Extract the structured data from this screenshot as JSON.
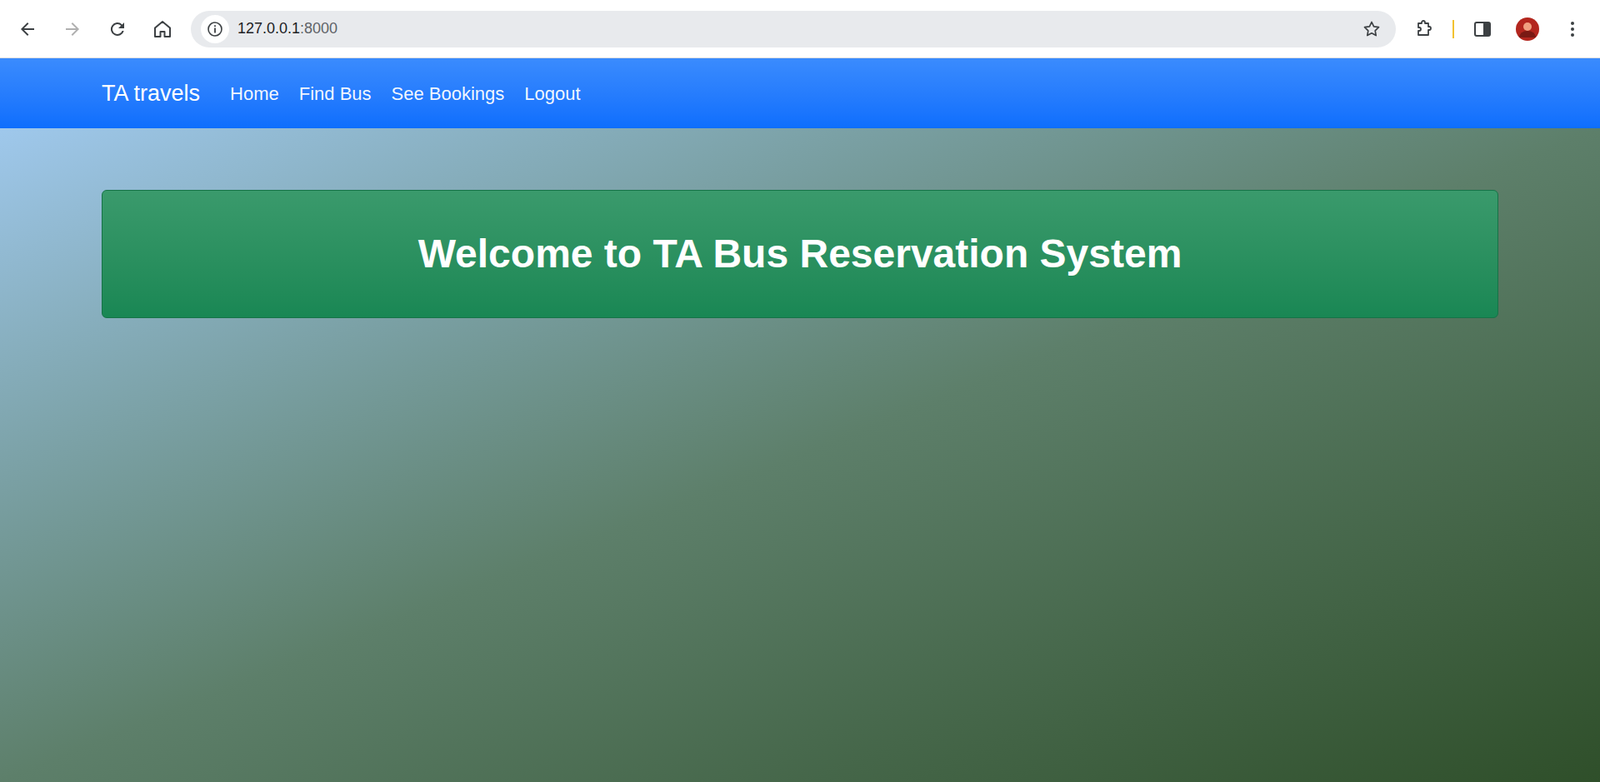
{
  "browser": {
    "url_host": "127.0.0.1",
    "url_port": ":8000",
    "back_disabled": false,
    "forward_disabled": true
  },
  "navbar": {
    "brand": "TA travels",
    "links": [
      {
        "label": "Home",
        "selected": false
      },
      {
        "label": "Find Bus",
        "selected": false
      },
      {
        "label": "See Bookings",
        "selected": false
      },
      {
        "label": "Logout",
        "selected": false
      }
    ]
  },
  "banner": {
    "title": "Welcome to TA Bus Reservation System"
  }
}
